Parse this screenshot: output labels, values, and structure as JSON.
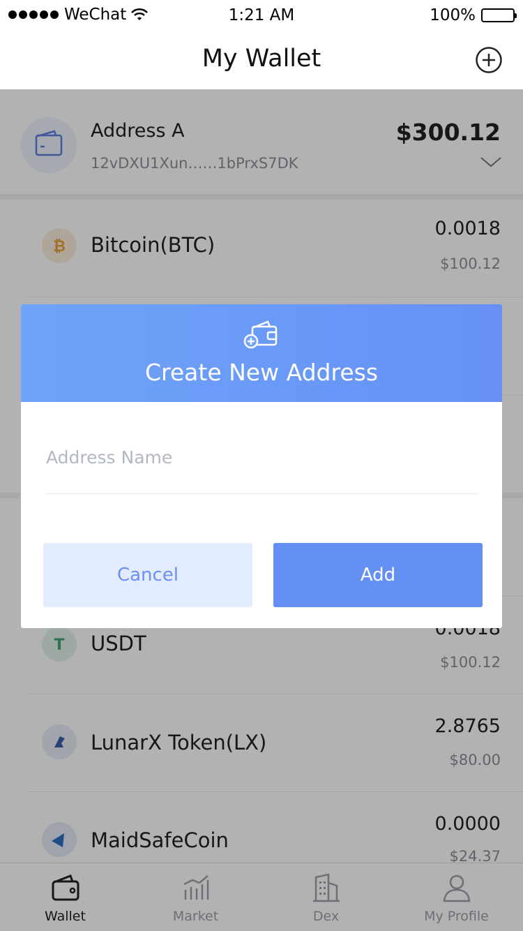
{
  "status_bar": {
    "carrier": "WeChat",
    "time": "1:21 AM",
    "battery": "100%"
  },
  "header": {
    "title": "My Wallet",
    "add_icon": "plus-circle-icon"
  },
  "address": {
    "name": "Address A",
    "hash": "12vDXU1Xun……1bPrxS7DK",
    "total": "$300.12"
  },
  "tokens": [
    {
      "name": "Bitcoin(BTC)",
      "amount": "0.0018",
      "fiat": "$100.12",
      "icon": "bitcoin-icon",
      "color": "#e8a03a"
    },
    {
      "name": "USDT",
      "amount": "0.0018",
      "fiat": "$100.12",
      "icon": "tether-icon",
      "color": "#4aa37a"
    },
    {
      "name": "LunarX Token(LX)",
      "amount": "2.8765",
      "fiat": "$80.00",
      "icon": "lunarx-icon",
      "color": "#3a5fa8"
    },
    {
      "name": "MaidSafeCoin",
      "amount": "0.0000",
      "fiat": "$24.37",
      "icon": "maidsafe-icon",
      "color": "#2d6fbf"
    }
  ],
  "tabs": [
    {
      "label": "Wallet",
      "icon": "wallet-icon",
      "active": true
    },
    {
      "label": "Market",
      "icon": "chart-icon",
      "active": false
    },
    {
      "label": "Dex",
      "icon": "building-icon",
      "active": false
    },
    {
      "label": "My Profile",
      "icon": "person-icon",
      "active": false
    }
  ],
  "modal": {
    "title": "Create New Address",
    "icon": "wallet-add-icon",
    "field": {
      "placeholder": "Address Name",
      "value": ""
    },
    "cancel_label": "Cancel",
    "add_label": "Add"
  },
  "colors": {
    "accent": "#6490f6",
    "accent_light": "#e3ecfe",
    "overlay": "rgba(0,0,0,0.30)"
  }
}
